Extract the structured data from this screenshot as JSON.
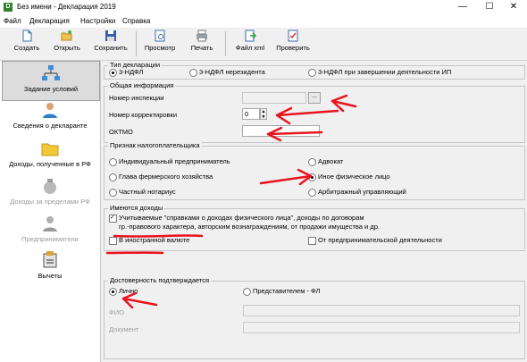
{
  "window": {
    "title": "Без имени - Декларация 2019",
    "minimize": "—",
    "maximize": "☐",
    "close": "✕"
  },
  "menu": [
    "Файл",
    "Декларация",
    "Настройки",
    "Справка"
  ],
  "toolbar": {
    "create": "Создать",
    "open": "Открыть",
    "save": "Сохранить",
    "preview": "Просмотр",
    "print": "Печать",
    "xml": "Файл xml",
    "check": "Проверить"
  },
  "sidebar": {
    "conditions": "Задание условий",
    "declarant": "Сведения о декларанте",
    "income_rf": "Доходы, полученные в РФ",
    "income_abroad": "Доходы за пределами РФ",
    "entrepreneurs": "Предприниматели",
    "deductions": "Вычеты"
  },
  "decl_type": {
    "title": "Тип декларации",
    "opt1": "3-НДФЛ",
    "opt2": "3-НДФЛ нерезидента",
    "opt3": "3-НДФЛ при завершении деятельности ИП"
  },
  "general": {
    "title": "Общая информация",
    "inspection_label": "Номер инспекции",
    "inspection_value": "",
    "browse": "...",
    "correction_label": "Номер корректировки",
    "correction_value": "0",
    "oktmo_label": "ОКТМО",
    "oktmo_value": ""
  },
  "taxpayer": {
    "title": "Признак налогоплательщика",
    "individual": "Индивидуальный предприниматель",
    "lawyer": "Адвокат",
    "farm_head": "Глава фермерского хозяйства",
    "other_person": "Иное физическое лицо",
    "notary": "Частный нотариус",
    "arbitr": "Арбитражный управляющий"
  },
  "income": {
    "title": "Имеются доходы",
    "certified_line1": "Учитываемые \"справками о доходах физического лица\", доходы по договорам",
    "certified_line2": "гр.-правового характера, авторским вознаграждениям, от продажи имущества и др.",
    "foreign": "В иностранной валюте",
    "entrepreneur": "От предпринимательской деятельности"
  },
  "reliability": {
    "title": "Достоверность подтверждается",
    "personal": "Лично",
    "representative": "Представителем - ФЛ",
    "fio_label": "ФИО",
    "document_label": "Документ"
  },
  "colors": {
    "annotation": "#e8141e"
  }
}
